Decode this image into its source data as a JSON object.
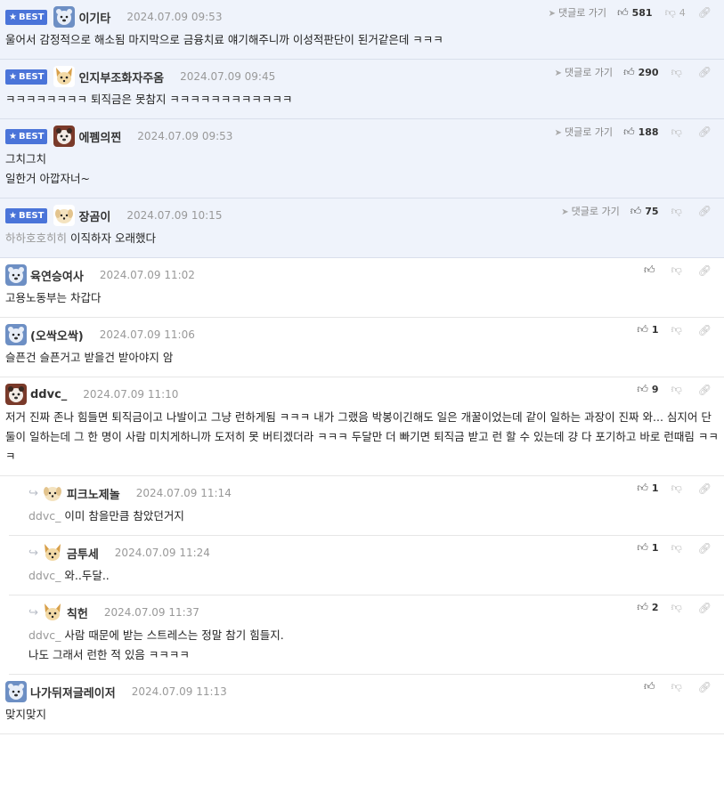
{
  "labels": {
    "best": "BEST",
    "goto": "댓글로 가기"
  },
  "comments": [
    {
      "best": true,
      "reply": false,
      "avatar": "bear",
      "nick": "이기타",
      "date": "2024.07.09 09:53",
      "up": "581",
      "down": "4",
      "goto": true,
      "mention": "",
      "text": "울어서 감정적으로 해소됨 마지막으로 금융치료 얘기해주니까 이성적판단이 된거같은데 ㅋㅋㅋ"
    },
    {
      "best": true,
      "reply": false,
      "avatar": "fox",
      "nick": "인지부조화자주옴",
      "date": "2024.07.09 09:45",
      "up": "290",
      "down": "",
      "goto": true,
      "mention": "",
      "text": "ㅋㅋㅋㅋㅋㅋㅋㅋ 퇴직금은 못참지 ㅋㅋㅋㅋㅋㅋㅋㅋㅋㅋㅋㅋ"
    },
    {
      "best": true,
      "reply": false,
      "avatar": "bear2",
      "nick": "에펨의찐",
      "date": "2024.07.09 09:53",
      "up": "188",
      "down": "",
      "goto": true,
      "mention": "",
      "text": "그치그치\n일한거 아깝자너~"
    },
    {
      "best": true,
      "reply": false,
      "avatar": "puppy",
      "nick": "장곰이",
      "date": "2024.07.09 10:15",
      "up": "75",
      "down": "",
      "goto": true,
      "mention": "하하호호히히",
      "text": "이직하자 오래했다"
    },
    {
      "best": false,
      "reply": false,
      "avatar": "bear",
      "nick": "육연승여사",
      "date": "2024.07.09 11:02",
      "up": "",
      "down": "",
      "goto": false,
      "mention": "",
      "text": "고용노동부는 차갑다"
    },
    {
      "best": false,
      "reply": false,
      "avatar": "bear",
      "nick": "(오싹오싹)",
      "date": "2024.07.09 11:06",
      "up": "1",
      "down": "",
      "goto": false,
      "mention": "",
      "text": "슬픈건 슬픈거고 받을건 받아야지 암"
    },
    {
      "best": false,
      "reply": false,
      "avatar": "bear2",
      "nick": "ddvc_",
      "date": "2024.07.09 11:10",
      "up": "9",
      "down": "",
      "goto": false,
      "mention": "",
      "text": "저거 진짜 존나 힘들면 퇴직금이고 나발이고 그냥 런하게됨 ㅋㅋㅋ 내가 그랬음 박봉이긴해도 일은 개꿀이었는데 같이 일하는 과장이 진짜 와... 심지어 단 둘이 일하는데 그 한 명이 사람 미치게하니까 도저히 못 버티겠더라 ㅋㅋㅋ 두달만 더 빠기면 퇴직금 받고 런 할 수 있는데 걍 다 포기하고 바로 런때림 ㅋㅋㅋ"
    },
    {
      "best": false,
      "reply": true,
      "avatar": "puppy",
      "nick": "피크노제놀",
      "date": "2024.07.09 11:14",
      "up": "1",
      "down": "",
      "goto": false,
      "mention": "ddvc_",
      "text": "이미 참을만큼 참았던거지"
    },
    {
      "best": false,
      "reply": true,
      "avatar": "fox",
      "nick": "금투세",
      "date": "2024.07.09 11:24",
      "up": "1",
      "down": "",
      "goto": false,
      "mention": "ddvc_",
      "text": "와..두달.."
    },
    {
      "best": false,
      "reply": true,
      "avatar": "fox",
      "nick": "칙헌",
      "date": "2024.07.09 11:37",
      "up": "2",
      "down": "",
      "goto": false,
      "mention": "ddvc_",
      "text": "사람 때문에 받는 스트레스는 정말 참기 힘들지.\n나도 그래서 런한 적 있음 ㅋㅋㅋㅋ"
    },
    {
      "best": false,
      "reply": false,
      "avatar": "bear",
      "nick": "나가뒤져글레이저",
      "date": "2024.07.09 11:13",
      "up": "",
      "down": "",
      "goto": false,
      "mention": "",
      "text": "맞지맞지"
    }
  ]
}
